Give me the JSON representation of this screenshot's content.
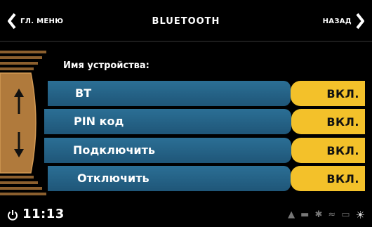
{
  "header": {
    "back_main_menu": "ГЛ. МЕНЮ",
    "title": "BLUETOOTH",
    "back": "НАЗАД"
  },
  "caption": "Имя устройства:",
  "rows": [
    {
      "label": "BT",
      "status": "ВКЛ."
    },
    {
      "label": "PIN код",
      "status": "ВКЛ."
    },
    {
      "label": "Подключить",
      "status": "ВКЛ."
    },
    {
      "label": "Отключить",
      "status": "ВКЛ."
    }
  ],
  "statusbar": {
    "time": "11:13",
    "icons": [
      "power-icon",
      "navigation-icon",
      "battery-icon",
      "bluetooth-icon",
      "wifi-icon",
      "signal-icon",
      "brightness-icon"
    ]
  },
  "colors": {
    "row_blue": "#1f5a7d",
    "status_yellow": "#f3c12a",
    "scroll_bronze": "#b07a3c"
  }
}
